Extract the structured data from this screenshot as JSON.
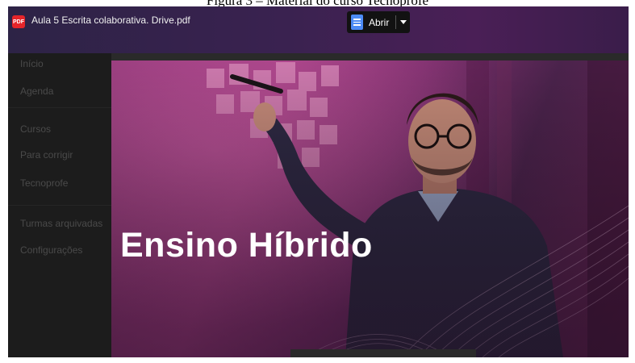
{
  "figure_caption": "Figura 3 – Material do curso Tecnoprofe",
  "window": {
    "file_icon": "PDF",
    "file_title": "Aula 5 Escrita colaborativa. Drive.pdf",
    "open_button_label": "Abrir"
  },
  "sidebar": {
    "items": [
      {
        "label": "Início"
      },
      {
        "label": "Agenda"
      },
      {
        "label": "Cursos"
      },
      {
        "label": "Para corrigir"
      },
      {
        "label": "Tecnoprofe"
      },
      {
        "label": "Turmas arquivadas"
      },
      {
        "label": "Configurações"
      }
    ]
  },
  "slide": {
    "title": "Ensino Híbrido"
  },
  "colors": {
    "pdf_badge": "#e5252a",
    "docs_icon": "#4c8bf5",
    "slide_magenta": "#a33d83"
  }
}
